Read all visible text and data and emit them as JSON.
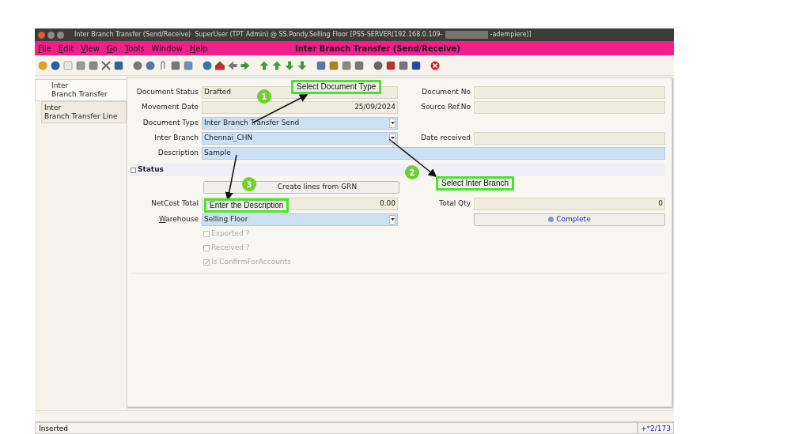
{
  "window": {
    "title_parts": [
      "Inter Branch Transfer (Send/Receive)  SuperUser (TPT Admin) @ SS.Pondy.Selling Floor [PSS-SERVER(192.168.0.109-",
      "-adempiere)]"
    ]
  },
  "menu": [
    {
      "label": "File",
      "underlined": true
    },
    {
      "label": "Edit",
      "underlined": true
    },
    {
      "label": "View",
      "underlined": true
    },
    {
      "label": "Go",
      "underlined": true
    },
    {
      "label": "Tools",
      "underlined": true
    },
    {
      "label": "Window",
      "underlined": false
    },
    {
      "label": "Help",
      "underlined": true
    }
  ],
  "header_title": "Inter Branch Transfer (Send/Receive)",
  "tabs": [
    {
      "label": "Inter\nBranch Transfer",
      "selected": true
    },
    {
      "label": "Inter\nBranch Transfer Line",
      "selected": false
    }
  ],
  "form": {
    "document_status": {
      "label": "Document Status",
      "value": "Drafted"
    },
    "document_no": {
      "label": "Document No"
    },
    "movement_date": {
      "label": "Movement Date",
      "value": "25/09/2024"
    },
    "source_ref_no": {
      "label": "Source Ref.No"
    },
    "document_type": {
      "label": "Document Type",
      "value": "Inter Branch Transfer Send"
    },
    "inter_branch": {
      "label": "Inter Branch",
      "value": "Chennai_CHN"
    },
    "date_received": {
      "label": "Date received"
    },
    "description": {
      "label": "Description",
      "value": "Sample"
    },
    "status_section": "Status",
    "create_lines_button": "Create lines from GRN",
    "netcost_total": {
      "label": "NetCost Total",
      "value": "0.00"
    },
    "total_qty": {
      "label": "Total Qty",
      "value": "0"
    },
    "warehouse": {
      "label": "Warehouse",
      "value": "Selling Floor"
    },
    "complete_button": "Complete",
    "checkboxes": [
      {
        "label": "Exported ?",
        "checked": false,
        "disabled": true
      },
      {
        "label": "Received ?",
        "checked": false,
        "disabled": true
      },
      {
        "label": "Is ConfirmForAccounts",
        "checked": true,
        "disabled": true
      }
    ]
  },
  "annotations": [
    {
      "number": "1",
      "label": "Select Document Type"
    },
    {
      "number": "2",
      "label": "Select Inter Branch"
    },
    {
      "number": "3",
      "label": "Enter the Description"
    }
  ],
  "status_bar": {
    "message": "Inserted",
    "record": "+*2/173"
  }
}
